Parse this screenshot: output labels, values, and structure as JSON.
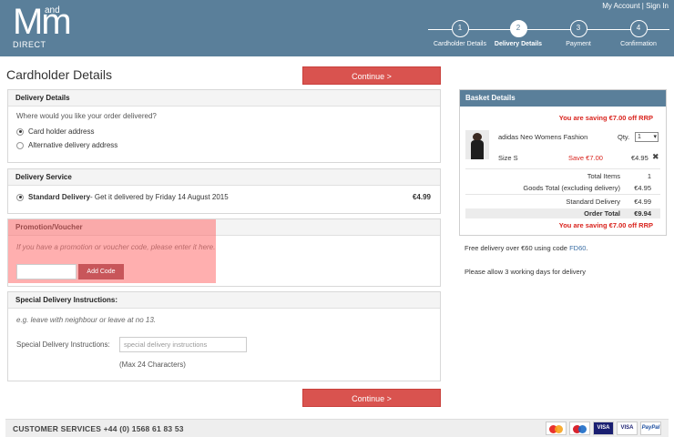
{
  "header": {
    "logo": {
      "mm": "Mm",
      "and": "and",
      "direct": "DIRECT"
    },
    "my_account": "My Account",
    "separator": "|",
    "sign_in": "Sign In",
    "steps": [
      {
        "num": "1",
        "label": "Cardholder Details"
      },
      {
        "num": "2",
        "label": "Delivery Details"
      },
      {
        "num": "3",
        "label": "Payment"
      },
      {
        "num": "4",
        "label": "Confirmation"
      }
    ]
  },
  "page_title": "Cardholder Details",
  "continue_label": "Continue >",
  "delivery_details": {
    "title": "Delivery Details",
    "question": "Where would you like your order delivered?",
    "options": [
      "Card holder address",
      "Alternative delivery address"
    ]
  },
  "delivery_service": {
    "title": "Delivery Service",
    "option_name": "Standard Delivery",
    "option_desc": " - Get it delivered by Friday 14 August 2015",
    "price": "€4.99"
  },
  "promo": {
    "title": "Promotion/Voucher",
    "hint": "If you have a promotion or voucher code, please enter it here.",
    "button": "Add Code"
  },
  "special": {
    "title": "Special Delivery Instructions:",
    "hint": "e.g. leave with neighbour or leave at no 13.",
    "label": "Special Delivery Instructions:",
    "placeholder": "special delivery instructions",
    "max_note": "(Max 24 Characters)"
  },
  "basket": {
    "title": "Basket Details",
    "saving": "You are saving €7.00 off RRP",
    "product": "adidas Neo Womens Fashion",
    "qty_label": "Qty.",
    "qty_value": "1",
    "size": "Size  S",
    "save": "Save  €7.00",
    "price": "€4.95",
    "remove_icon": "✖",
    "totals": [
      {
        "label": "Total Items",
        "value": "1"
      },
      {
        "label": "Goods Total (excluding delivery)",
        "value": "€4.95"
      },
      {
        "label": "Standard Delivery",
        "value": "€4.99"
      }
    ],
    "order_total_label": "Order Total",
    "order_total_value": "€9.94"
  },
  "side_notes": {
    "free_delivery_prefix": "Free delivery over €60 using code ",
    "free_delivery_code": "FD60",
    "free_delivery_suffix": ".",
    "working_days": "Please allow 3 working days for delivery"
  },
  "footer": {
    "customer_services": "CUSTOMER SERVICES +44 (0) 1568 61 83 53",
    "cards": [
      "mastercard",
      "maestro",
      "VISA",
      "VISA",
      "PayPal"
    ]
  },
  "colors": {
    "header_bg": "#5a7f9a",
    "accent_red": "#d9534f",
    "promo_highlight": "#ff6e6e",
    "link_blue": "#3a6ea5"
  }
}
